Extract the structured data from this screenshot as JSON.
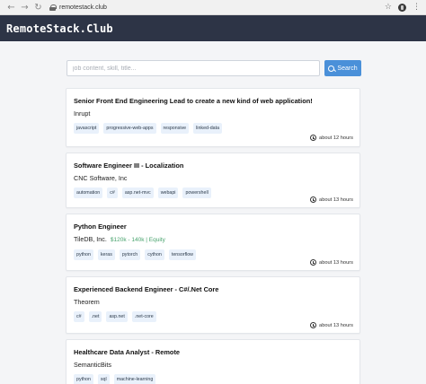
{
  "browser": {
    "url": "remotestack.club"
  },
  "header": {
    "brand": "RemoteStack.Club"
  },
  "search": {
    "placeholder": "job content, skill, title...",
    "button_label": "Search"
  },
  "jobs": [
    {
      "title": "Senior Front End Engineering Lead to create a new kind of web application!",
      "company": "Inrupt",
      "salary": "",
      "tags": [
        "javascript",
        "progressive-web-apps",
        "responsive",
        "linked-data"
      ],
      "time": "about 12 hours"
    },
    {
      "title": "Software Engineer III - Localization",
      "company": "CNC Software, Inc",
      "salary": "",
      "tags": [
        "automation",
        "c#",
        "asp.net-mvc",
        "webapi",
        "powershell"
      ],
      "time": "about 13 hours"
    },
    {
      "title": "Python Engineer",
      "company": "TileDB, Inc.",
      "salary": "$120k - 140k | Equity",
      "tags": [
        "python",
        "keras",
        "pytorch",
        "cython",
        "tensorflow"
      ],
      "time": "about 13 hours"
    },
    {
      "title": "Experienced Backend Engineer - C#/.Net Core",
      "company": "Theorem",
      "salary": "",
      "tags": [
        "c#",
        ".net",
        "asp.net",
        ".net-core"
      ],
      "time": "about 13 hours"
    },
    {
      "title": "Healthcare Data Analyst - Remote",
      "company": "SemanticBits",
      "salary": "",
      "tags": [
        "python",
        "sql",
        "machine-learning"
      ],
      "time": ""
    }
  ]
}
